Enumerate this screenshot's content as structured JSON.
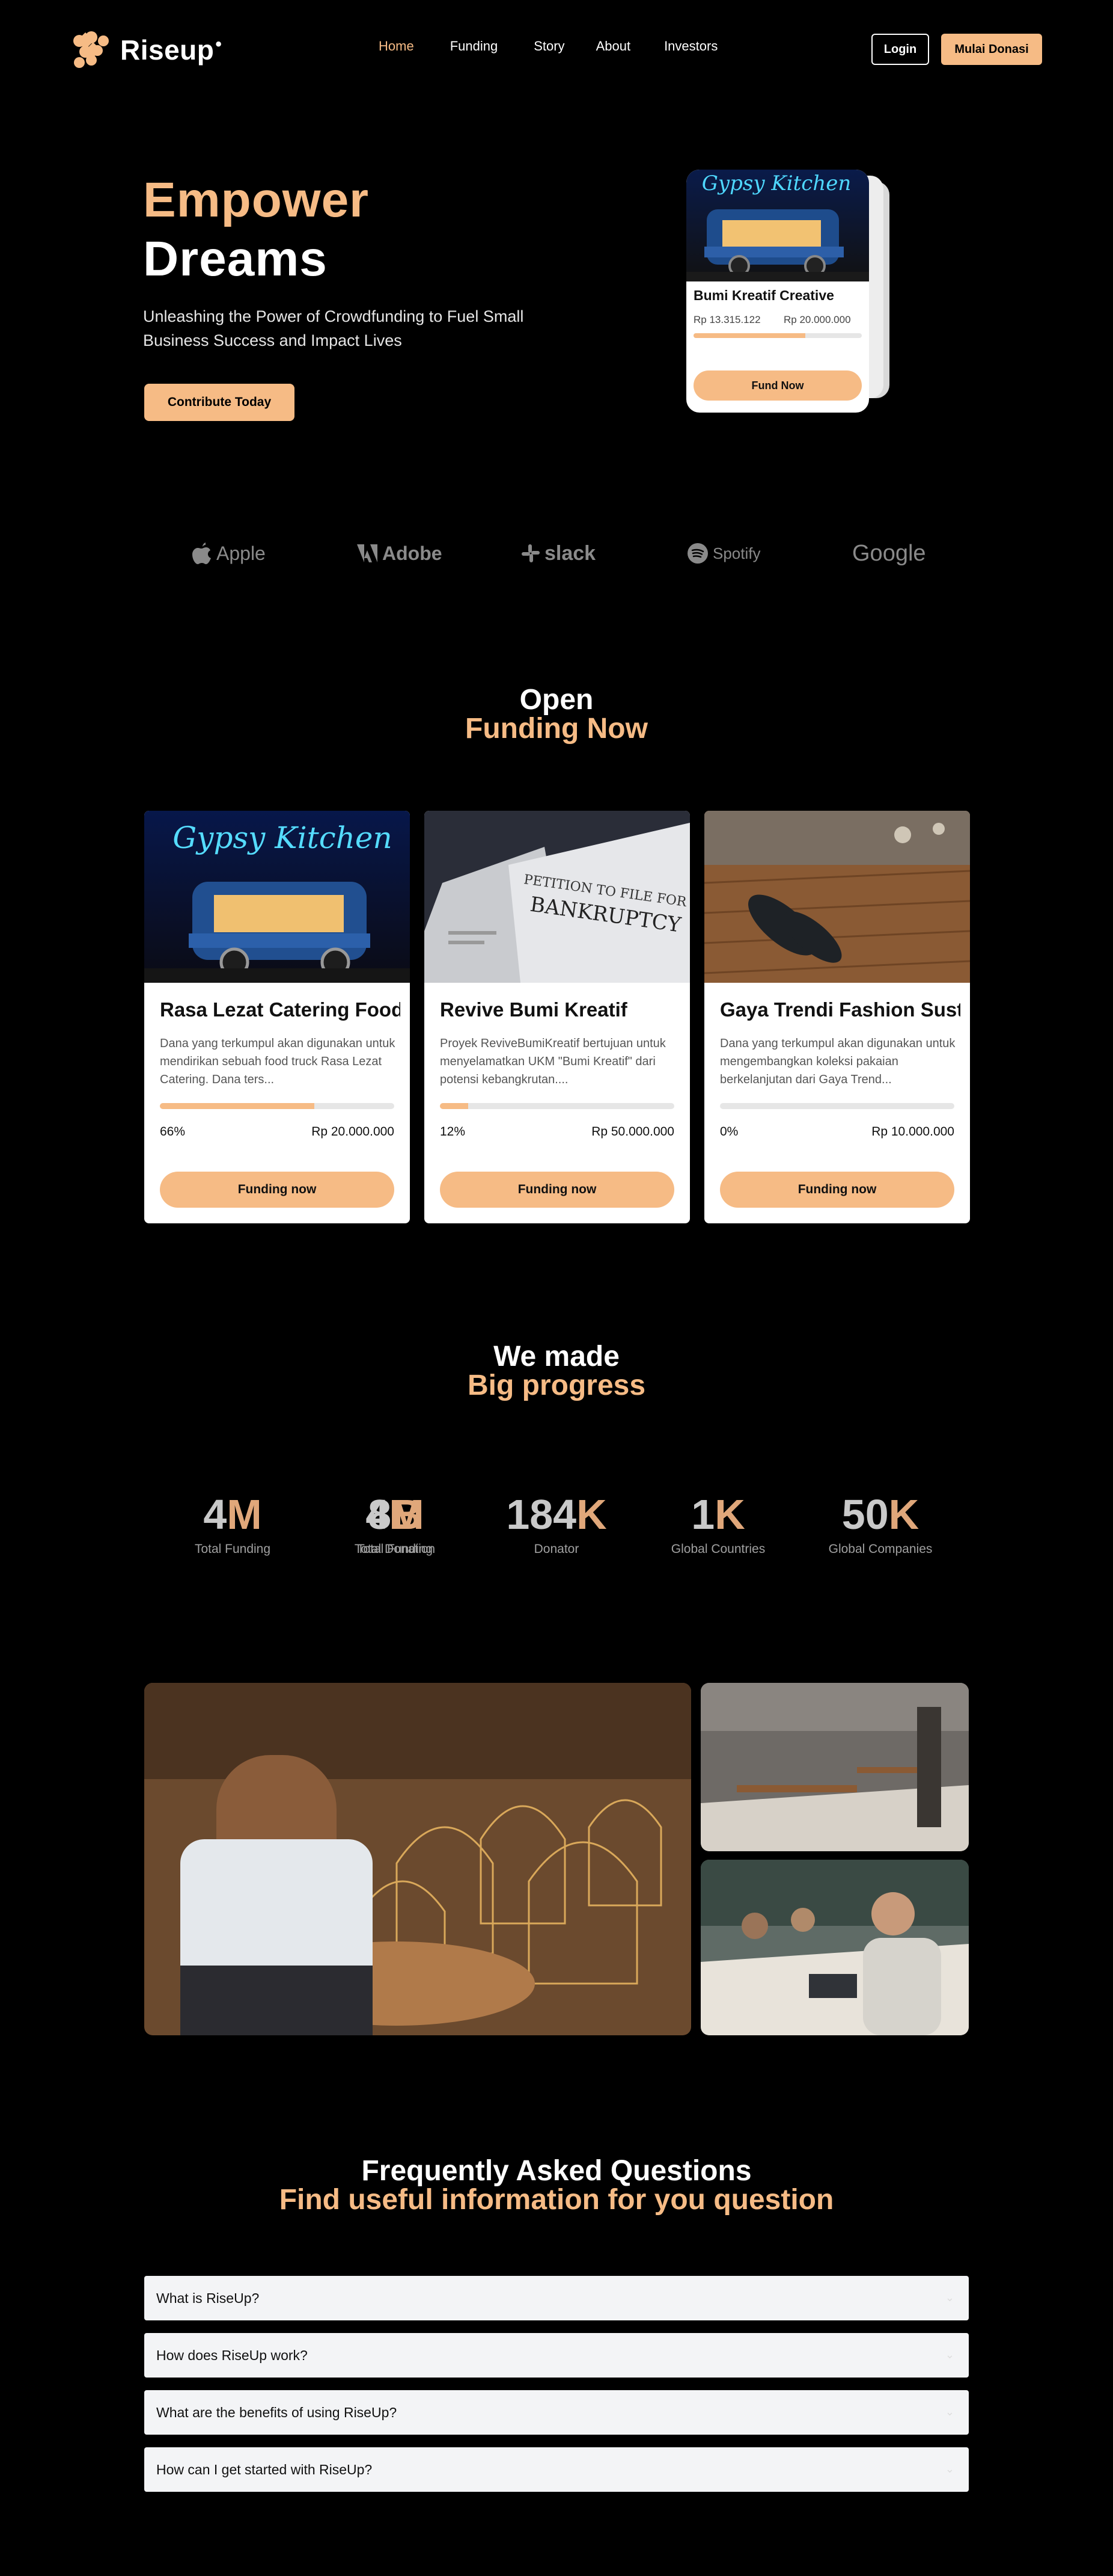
{
  "brand": {
    "name": "Riseup",
    "accent": "#F6BB85",
    "background": "#000000"
  },
  "nav": {
    "items": [
      {
        "label": "Home",
        "active": true
      },
      {
        "label": "Funding",
        "active": false
      },
      {
        "label": "Story",
        "active": false
      },
      {
        "label": "About",
        "active": false
      },
      {
        "label": "Investors",
        "active": false
      }
    ],
    "login_label": "Login",
    "donate_label": "Mulai Donasi"
  },
  "hero": {
    "title_line1": "Empower",
    "title_line2": "Dreams",
    "subtitle": "Unleashing the Power of Crowdfunding to Fuel Small Business Success and Impact Lives",
    "cta_label": "Contribute Today",
    "card": {
      "title": "Bumi Kreatif Creative",
      "raised": "Rp 13.315.122",
      "goal": "Rp 20.000.000",
      "progress": 0.666,
      "button_label": "Fund Now",
      "sign_text": "Gypsy Kitchen"
    }
  },
  "partners": [
    "Apple",
    "Adobe",
    "slack",
    "Spotify",
    "Google"
  ],
  "funding_section": {
    "title_line1": "Open",
    "title_line2": "Funding Now",
    "cards": [
      {
        "title": "Rasa Lezat Catering Food Truck",
        "description": "Dana yang terkumpul akan digunakan untuk mendirikan sebuah food truck Rasa Lezat Catering. Dana ters...",
        "percent_label": "66%",
        "progress": 0.66,
        "goal": "Rp 20.000.000",
        "button_label": "Funding now",
        "image_icon": "food-truck-photo",
        "sign_text": "Gypsy Kitchen"
      },
      {
        "title": "Revive Bumi Kreatif",
        "description": "Proyek ReviveBumiKreatif bertujuan untuk menyelamatkan UKM \"Bumi Kreatif\" dari potensi kebangkrutan....",
        "percent_label": "12%",
        "progress": 0.12,
        "goal": "Rp 50.000.000",
        "button_label": "Funding now",
        "image_icon": "bankruptcy-petition-photo",
        "doc_line1": "PETITION TO FILE FOR",
        "doc_line2": "BANKRUPTCY"
      },
      {
        "title": "Gaya Trendi Fashion Sustainable",
        "description": "Dana yang terkumpul akan digunakan untuk mengembangkan koleksi pakaian berkelanjutan dari Gaya Trend...",
        "percent_label": "0%",
        "progress": 0,
        "goal": "Rp 10.000.000",
        "button_label": "Funding now",
        "image_icon": "fashion-workshop-photo"
      }
    ]
  },
  "progress_section": {
    "title_line1": "We made",
    "title_line2": "Big progress",
    "stats": [
      {
        "number": "4",
        "suffix": "M",
        "label": "Total Funding"
      },
      {
        "number": "8",
        "suffix": "B",
        "label": "Total Donation"
      },
      {
        "number": "184",
        "suffix": "K",
        "label": "Donator"
      },
      {
        "number": "1",
        "suffix": "K",
        "label": "Global Countries"
      },
      {
        "number": "50",
        "suffix": "K",
        "label": "Global Companies"
      }
    ]
  },
  "gallery": [
    "craftsman-birdcage-photo",
    "office-space-photo",
    "team-meeting-photo"
  ],
  "faq_section": {
    "title_line1": "Frequently Asked Questions",
    "title_line2": "Find useful information for you question",
    "items": [
      "What is RiseUp?",
      "How does RiseUp work?",
      "What are the benefits of using RiseUp?",
      "How can I get started with RiseUp?"
    ]
  }
}
